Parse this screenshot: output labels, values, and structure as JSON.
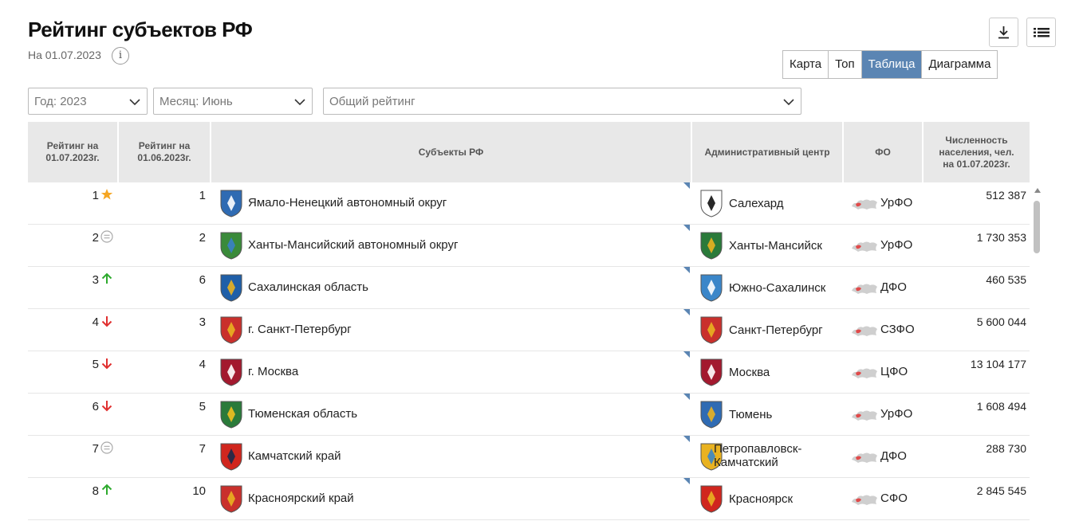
{
  "header": {
    "title": "Рейтинг субъектов РФ",
    "date": "На 01.07.2023",
    "info_glyph": "i"
  },
  "view_tabs": [
    "Карта",
    "Топ",
    "Таблица",
    "Диаграмма"
  ],
  "active_view": "Таблица",
  "filters": {
    "year": "Год: 2023",
    "month": "Месяц: Июнь",
    "rating_type": "Общий рейтинг"
  },
  "table": {
    "columns": [
      "Рейтинг на 01.07.2023г.",
      "Рейтинг на 01.06.2023г.",
      "Субъекты РФ",
      "Административный центр",
      "ФО",
      "Численность населения, чел. на 01.07.2023г."
    ],
    "rows": [
      {
        "rank": "1",
        "mark": "star",
        "prev": "1",
        "subject": "Ямало-Ненецкий автономный округ",
        "center": "Салехард",
        "fo": "УрФО",
        "population": "512 387"
      },
      {
        "rank": "2",
        "mark": "equal",
        "prev": "2",
        "subject": "Ханты-Мансийский автономный округ",
        "center": "Ханты-Мансийск",
        "fo": "УрФО",
        "population": "1 730 353"
      },
      {
        "rank": "3",
        "mark": "up",
        "prev": "6",
        "subject": "Сахалинская область",
        "center": "Южно-Сахалинск",
        "fo": "ДФО",
        "population": "460 535"
      },
      {
        "rank": "4",
        "mark": "down",
        "prev": "3",
        "subject": "г. Санкт-Петербург",
        "center": "Санкт-Петербург",
        "fo": "СЗФО",
        "population": "5 600 044"
      },
      {
        "rank": "5",
        "mark": "down",
        "prev": "4",
        "subject": "г. Москва",
        "center": "Москва",
        "fo": "ЦФО",
        "population": "13 104 177"
      },
      {
        "rank": "6",
        "mark": "down",
        "prev": "5",
        "subject": "Тюменская область",
        "center": "Тюмень",
        "fo": "УрФО",
        "population": "1 608 494"
      },
      {
        "rank": "7",
        "mark": "equal",
        "prev": "7",
        "subject": "Камчатский край",
        "center": "Петропавловск-Камчатский",
        "fo": "ДФО",
        "population": "288 730"
      },
      {
        "rank": "8",
        "mark": "up",
        "prev": "10",
        "subject": "Красноярский край",
        "center": "Красноярск",
        "fo": "СФО",
        "population": "2 845 545"
      }
    ]
  },
  "colors": {
    "accent": "#5b85b3",
    "star": "#f5a623",
    "up": "#2eaa2e",
    "down": "#e03030",
    "equal": "#aaaaaa",
    "header_bg": "#e8e8e8",
    "fo_highlight": "#e14a4a"
  }
}
